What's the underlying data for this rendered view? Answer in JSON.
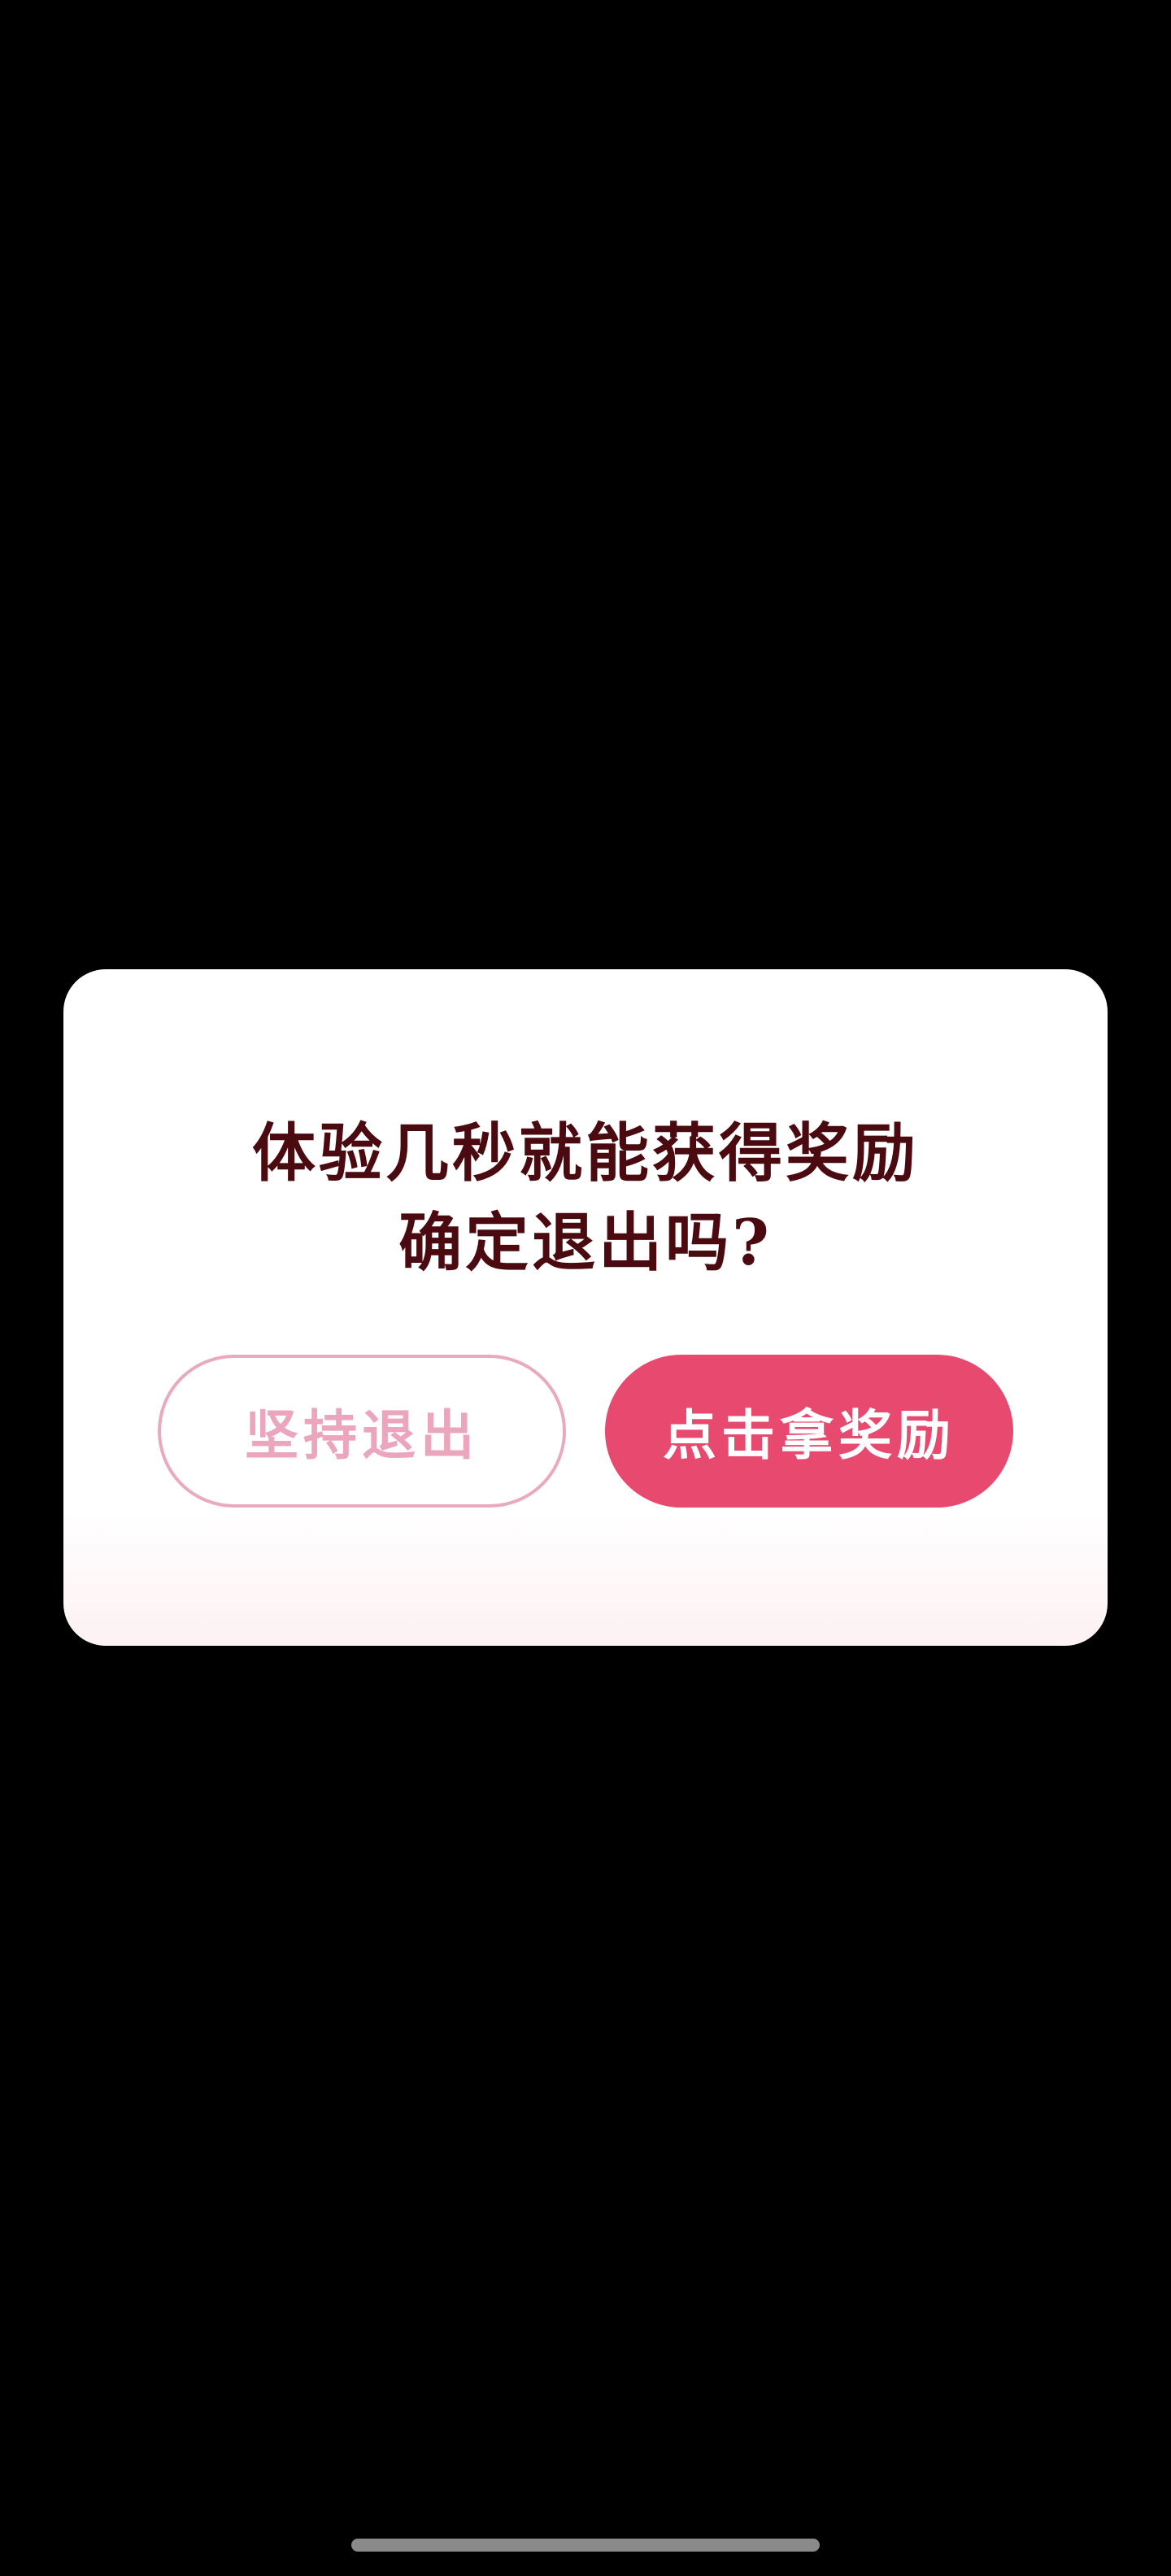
{
  "dialog": {
    "message_line1": "体验几秒就能获得奖励",
    "message_line2": "确定退出吗?",
    "exit_button_label": "坚持退出",
    "reward_button_label": "点击拿奖励"
  },
  "colors": {
    "title": "#4a0a0f",
    "accent": "#e84a6f",
    "exit_border": "#e9a9bf"
  }
}
